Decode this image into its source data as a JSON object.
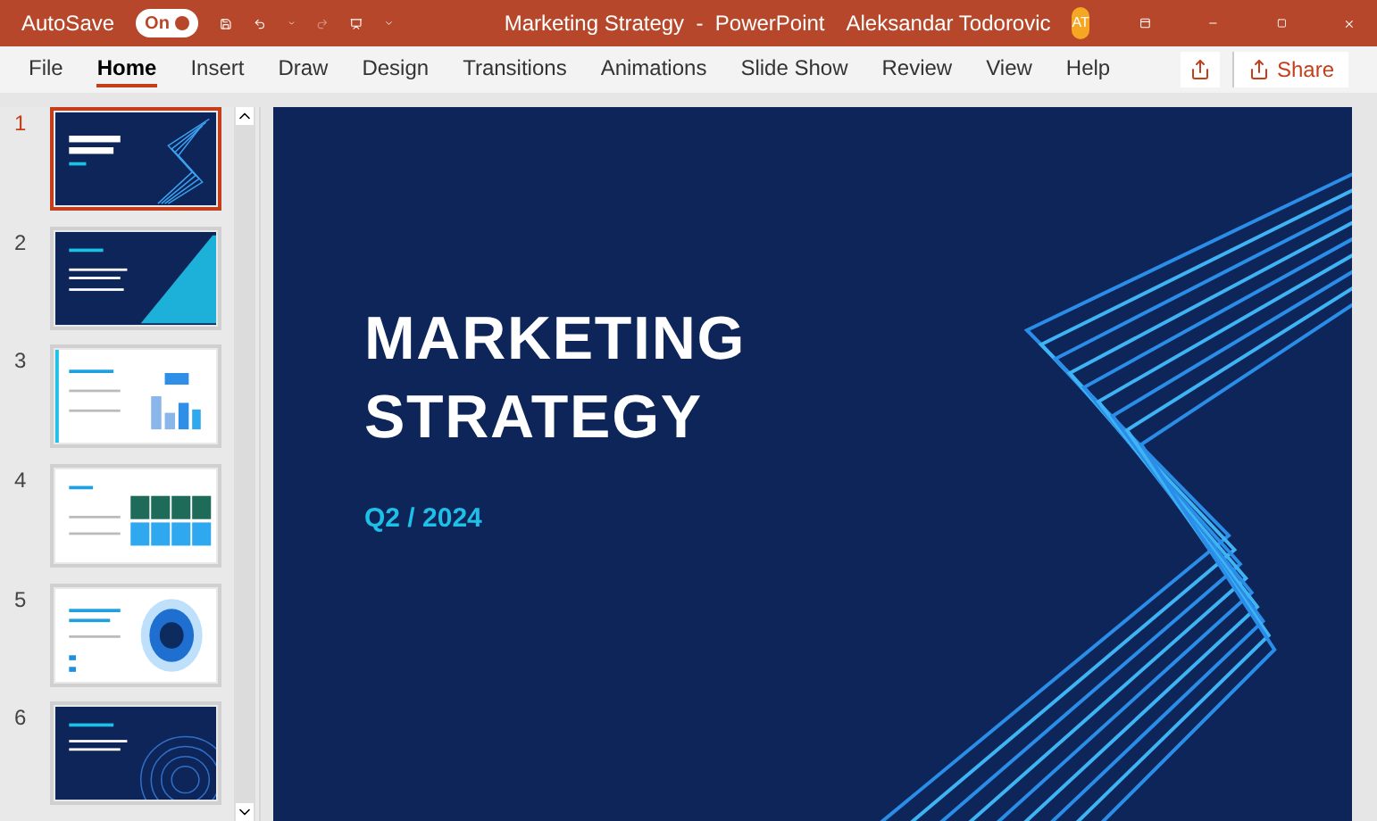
{
  "title_bar": {
    "autosave_label": "AutoSave",
    "autosave_toggle": {
      "label": "On",
      "on": true
    },
    "title": "Marketing Strategy  -  PowerPoint",
    "user_name": "Aleksandar Todorovic",
    "avatar_initials": "AT"
  },
  "ribbon_tabs": [
    {
      "label": "File",
      "selected": false
    },
    {
      "label": "Home",
      "selected": true
    },
    {
      "label": "Insert",
      "selected": false
    },
    {
      "label": "Draw",
      "selected": false
    },
    {
      "label": "Design",
      "selected": false
    },
    {
      "label": "Transitions",
      "selected": false
    },
    {
      "label": "Animations",
      "selected": false
    },
    {
      "label": "Slide Show",
      "selected": false
    },
    {
      "label": "Review",
      "selected": false
    },
    {
      "label": "View",
      "selected": false
    },
    {
      "label": "Help",
      "selected": false
    }
  ],
  "share_button": "Share",
  "thumbnails": [
    {
      "number": "1",
      "selected": true,
      "kind": "title"
    },
    {
      "number": "2",
      "selected": false,
      "kind": "diagonal"
    },
    {
      "number": "3",
      "selected": false,
      "kind": "bars"
    },
    {
      "number": "4",
      "selected": false,
      "kind": "grid"
    },
    {
      "number": "5",
      "selected": false,
      "kind": "circle"
    },
    {
      "number": "6",
      "selected": false,
      "kind": "rings"
    }
  ],
  "slide": {
    "title_lines": [
      "MARKETING",
      "STRATEGY"
    ],
    "subtitle": "Q2 / 2024"
  }
}
